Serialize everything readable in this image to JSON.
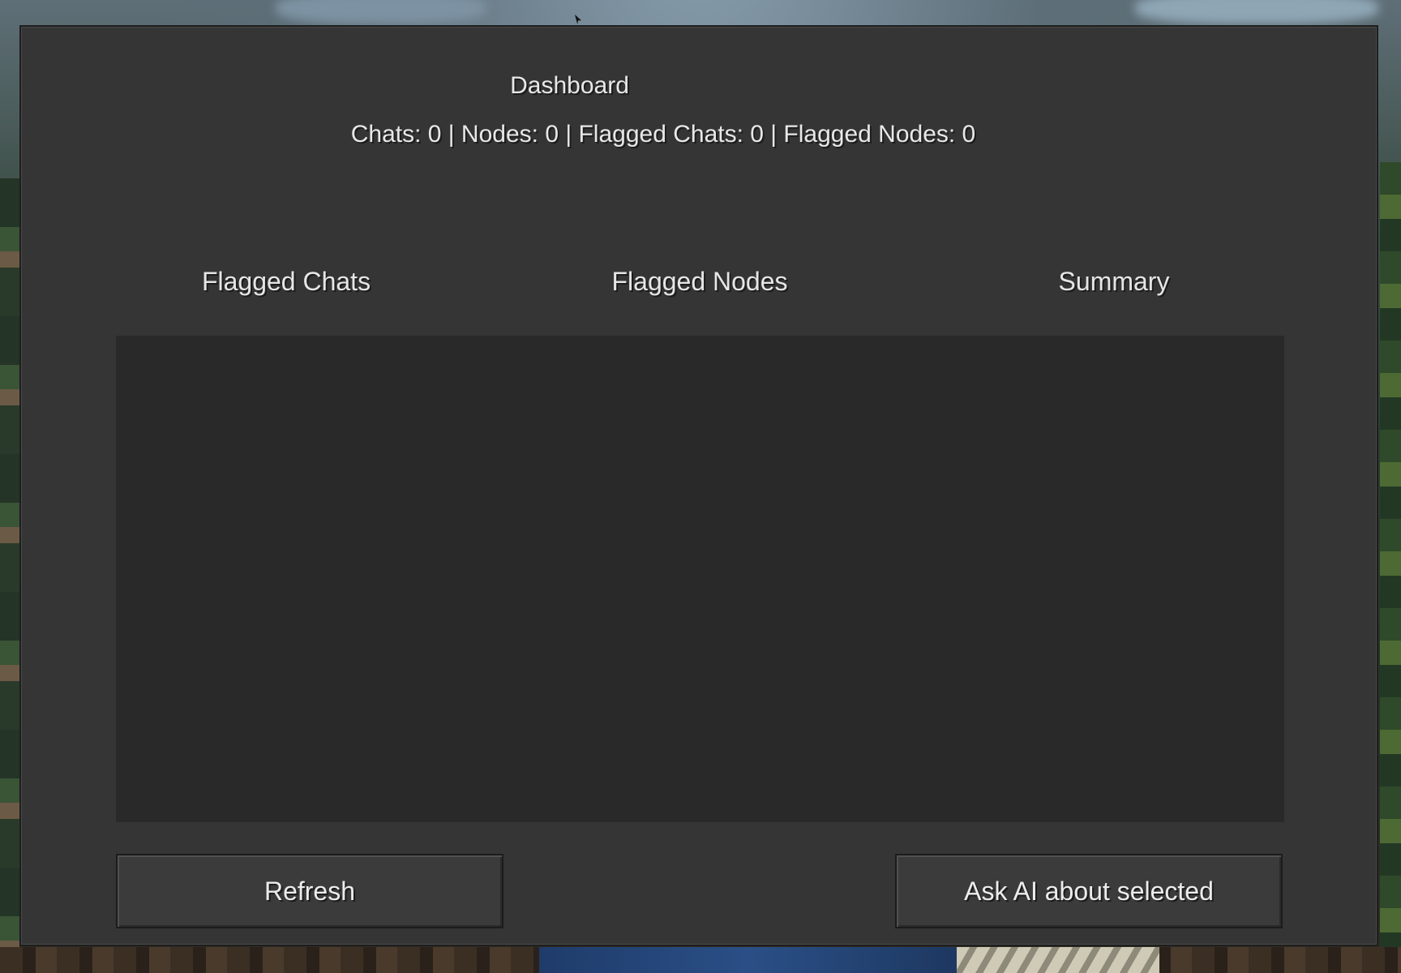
{
  "dialog": {
    "title": "Dashboard",
    "stats": "Chats: 0 | Nodes: 0 | Flagged Chats: 0 | Flagged Nodes: 0"
  },
  "tabs": [
    {
      "label": "Flagged Chats"
    },
    {
      "label": "Flagged Nodes"
    },
    {
      "label": "Summary"
    }
  ],
  "list": {
    "items": []
  },
  "buttons": {
    "refresh": "Refresh",
    "ask_ai": "Ask AI about selected"
  },
  "colors": {
    "dialog_bg": "#353535",
    "list_bg": "#292929",
    "button_bg": "#3b3b3b",
    "text": "#e8e8e8"
  }
}
